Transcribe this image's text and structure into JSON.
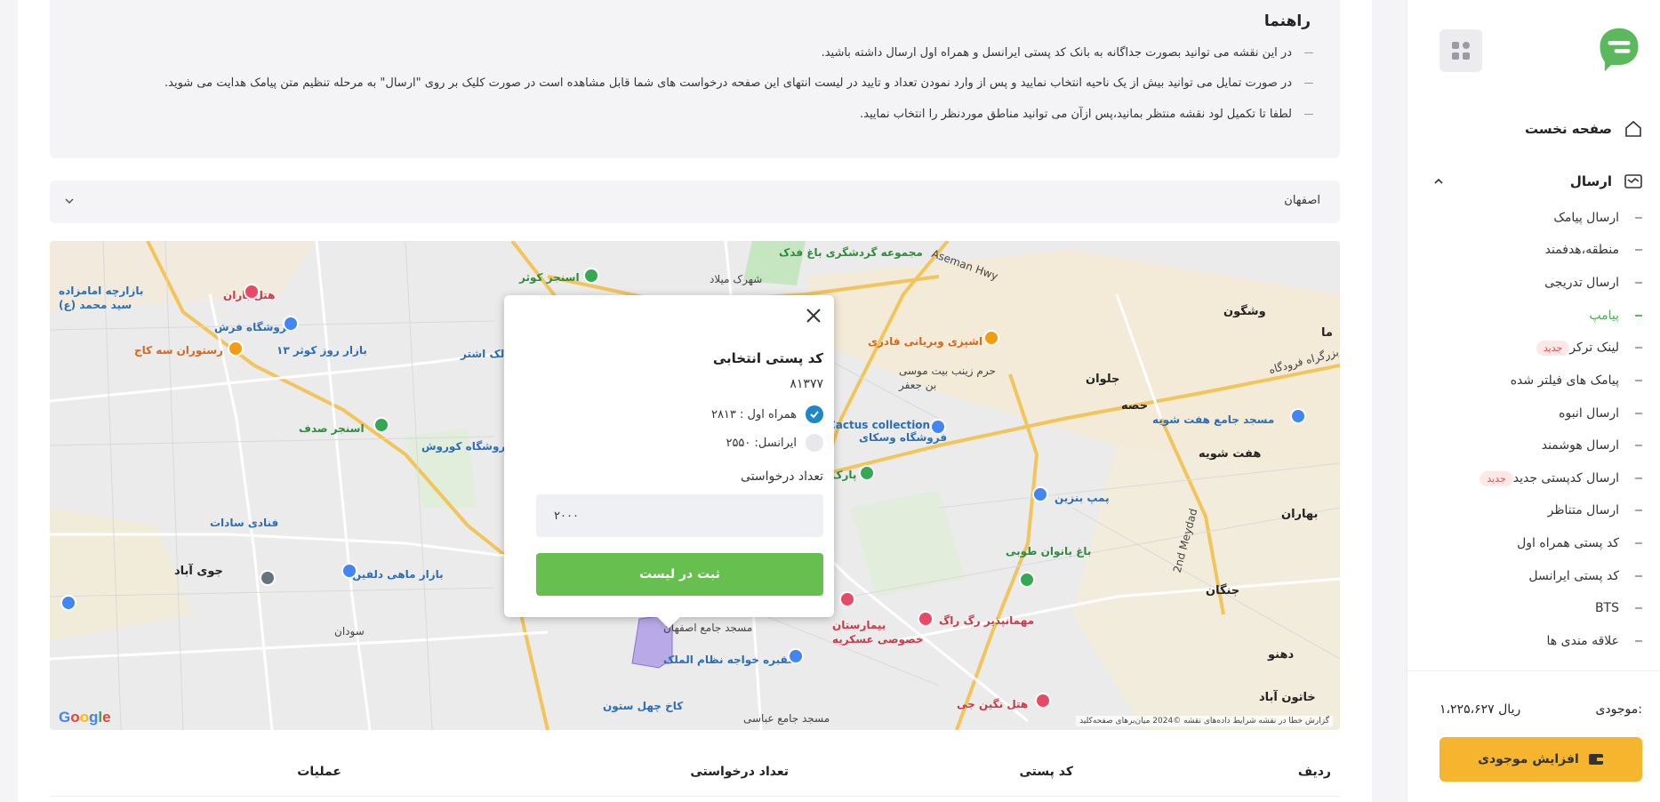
{
  "sidebar": {
    "home_label": "صفحه نخست",
    "send_label": "ارسال",
    "items": [
      {
        "label": "ارسال پیامک",
        "active": false,
        "badge": ""
      },
      {
        "label": "منطقه،هدفمند",
        "active": false,
        "badge": ""
      },
      {
        "label": "ارسال تدریجی",
        "active": false,
        "badge": ""
      },
      {
        "label": "پیامپ",
        "active": true,
        "badge": ""
      },
      {
        "label": "لینک ترکر",
        "active": false,
        "badge": "جدید"
      },
      {
        "label": "پیامک های فیلتر شده",
        "active": false,
        "badge": ""
      },
      {
        "label": "ارسال انبوه",
        "active": false,
        "badge": ""
      },
      {
        "label": "ارسال هوشمند",
        "active": false,
        "badge": ""
      },
      {
        "label": "ارسال کدپستی جدید",
        "active": false,
        "badge": "جدید"
      },
      {
        "label": "ارسال متناظر",
        "active": false,
        "badge": ""
      },
      {
        "label": "کد پستی همراه اول",
        "active": false,
        "badge": ""
      },
      {
        "label": "کد پستی ایرانسل",
        "active": false,
        "badge": ""
      },
      {
        "label": "BTS",
        "active": false,
        "badge": ""
      },
      {
        "label": "علاقه مندی ها",
        "active": false,
        "badge": ""
      }
    ],
    "balance_label": "موجودی:",
    "balance_value": "۱،۲۲۵،۶۲۷ ریال",
    "charge_label": "افزایش موجودی"
  },
  "guide": {
    "title": "راهنما",
    "lines": [
      "در این نقشه می توانید بصورت جداگانه به بانک کد پستی ایرانسل و همراه اول ارسال داشته باشید.",
      "در صورت تمایل می توانید بیش از یک ناحیه  انتخاب نمایید و پس از وارد نمودن تعداد و تایید در لیست انتهای این صفحه درخواست های شما قابل مشاهده است در صورت کلیک بر روی \"ارسال\" به مرحله تنظیم متن پیامک هدایت می شوید.",
      "لطفا تا تکمیل لود نقشه منتظر بمانید،پس ازآن می توانید مناطق موردنظر را انتخاب نمایید."
    ]
  },
  "city_select": {
    "value": "اصفهان"
  },
  "map": {
    "labels": [
      {
        "t": "مجموعه گردشگری باغ فدک",
        "c": "green"
      },
      {
        "t": "Aseman Hwy",
        "c": "plain"
      },
      {
        "t": "شهرک میلاد",
        "c": "plain"
      },
      {
        "t": "اسنجر کوثر",
        "c": "green"
      },
      {
        "t": "هتل باران",
        "c": "red"
      },
      {
        "t": "بازارچه امامزاده سید محمد (ع)",
        "c": "blue"
      },
      {
        "t": "فروشگاه فرش",
        "c": "blue"
      },
      {
        "t": "رستوران سه کاج",
        "c": "orange"
      },
      {
        "t": "بازار روز کوثر ۱۳",
        "c": "blue"
      },
      {
        "t": "مالک اشتر",
        "c": "blue"
      },
      {
        "t": "اسنجر صدف",
        "c": "green"
      },
      {
        "t": "فروشگاه کوروش",
        "c": "blue"
      },
      {
        "t": "فنادی سادات",
        "c": "blue"
      },
      {
        "t": "بازار ماهی دلفین",
        "c": "blue"
      },
      {
        "t": "جوی آباد",
        "c": "big"
      },
      {
        "t": "سودان",
        "c": "plain"
      },
      {
        "t": "اشپزی وبریانی فادری",
        "c": "orange"
      },
      {
        "t": "حرم زینب بیت موسی بن جعفر",
        "c": "plain"
      },
      {
        "t": "Cactus collection",
        "c": "blue"
      },
      {
        "t": "فروشگاه وسکای",
        "c": "blue"
      },
      {
        "t": "جلوان",
        "c": "big"
      },
      {
        "t": "حصه",
        "c": "big"
      },
      {
        "t": "وشگون",
        "c": "big"
      },
      {
        "t": "مسجد جامع هفت شویه",
        "c": "blue"
      },
      {
        "t": "هفت شویه",
        "c": "big"
      },
      {
        "t": "پارک ملت",
        "c": "green"
      },
      {
        "t": "پمپ بنزین",
        "c": "blue"
      },
      {
        "t": "باغ بانوان طوبی",
        "c": "green"
      },
      {
        "t": "بهاران",
        "c": "big"
      },
      {
        "t": "جنگان",
        "c": "big"
      },
      {
        "t": "مهمانپذیر رگ راگ",
        "c": "red"
      },
      {
        "t": "بیمارستان خصوصی عسکریه",
        "c": "red"
      },
      {
        "t": "مسجد جامع اصفهان",
        "c": "plain"
      },
      {
        "t": "مقبره خواجه نظام الملک",
        "c": "blue"
      },
      {
        "t": "کاخ چهل ستون",
        "c": "blue"
      },
      {
        "t": "مسجد جامع عباسی",
        "c": "plain"
      },
      {
        "t": "هتل نگین جی",
        "c": "red"
      },
      {
        "t": "دهنو",
        "c": "big"
      },
      {
        "t": "خاتون آباد",
        "c": "big"
      },
      {
        "t": "ما",
        "c": "big"
      },
      {
        "t": "بزرگراه فرودگاه",
        "c": "plain"
      },
      {
        "t": "2nd Meydad",
        "c": "plain"
      }
    ],
    "google": "Google",
    "footer": "گزارش خطا در نقشه   شرایط   داده‌های نقشه ©2024   میان‌برهای صفحه‌کلید"
  },
  "popup": {
    "title": "کد پستی انتخابی",
    "code": "۸۱۳۷۷",
    "option1": "همراه اول : ۲۸۱۳",
    "option2": "ایرانسل: ۲۵۵۰",
    "count_label": "تعداد درخواستی",
    "count_value": "۲۰۰۰",
    "submit_label": "ثبت در لیست"
  },
  "table": {
    "headers": [
      "ردیف",
      "کد پستی",
      "تعداد درخواستی",
      "عملیات"
    ]
  },
  "colors": {
    "accent_green": "#67bf4f",
    "accent_yellow": "#f5b52e",
    "radio_blue": "#1e88c7"
  }
}
